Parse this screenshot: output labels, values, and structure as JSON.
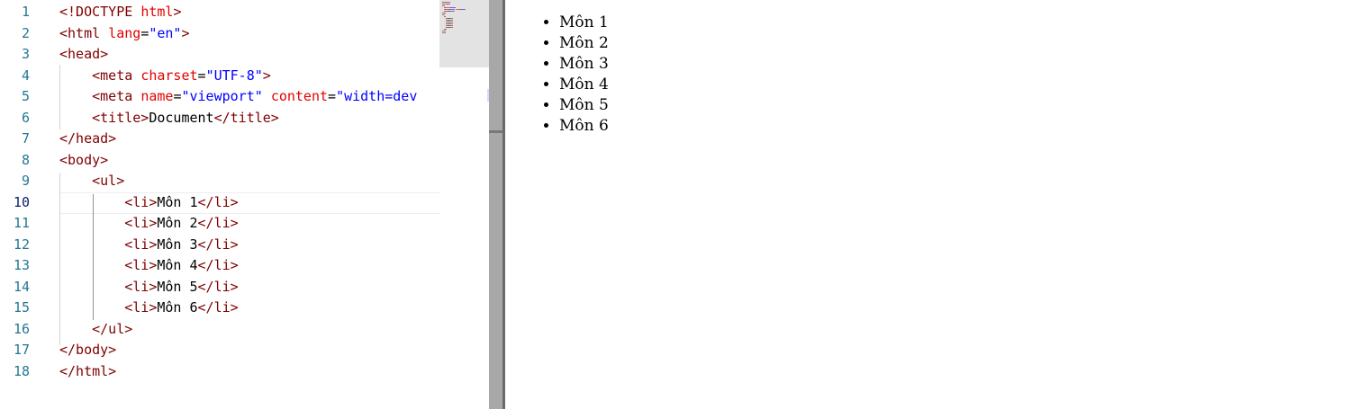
{
  "editor": {
    "active_line": 10,
    "lines": [
      {
        "n": "1",
        "tokens": [
          {
            "t": "tag",
            "v": "<!DOCTYPE "
          },
          {
            "t": "attr",
            "v": "html"
          },
          {
            "t": "tag",
            "v": ">"
          }
        ]
      },
      {
        "n": "2",
        "tokens": [
          {
            "t": "tag",
            "v": "<html "
          },
          {
            "t": "attr",
            "v": "lang"
          },
          {
            "t": "text",
            "v": "="
          },
          {
            "t": "val",
            "v": "\"en\""
          },
          {
            "t": "tag",
            "v": ">"
          }
        ]
      },
      {
        "n": "3",
        "tokens": [
          {
            "t": "tag",
            "v": "<head>"
          }
        ]
      },
      {
        "n": "4",
        "tokens": [
          {
            "t": "text",
            "v": "    "
          },
          {
            "t": "tag",
            "v": "<meta "
          },
          {
            "t": "attr",
            "v": "charset"
          },
          {
            "t": "text",
            "v": "="
          },
          {
            "t": "val",
            "v": "\"UTF-8\""
          },
          {
            "t": "tag",
            "v": ">"
          }
        ]
      },
      {
        "n": "5",
        "tokens": [
          {
            "t": "text",
            "v": "    "
          },
          {
            "t": "tag",
            "v": "<meta "
          },
          {
            "t": "attr",
            "v": "name"
          },
          {
            "t": "text",
            "v": "="
          },
          {
            "t": "val",
            "v": "\"viewport\""
          },
          {
            "t": "text",
            "v": " "
          },
          {
            "t": "attr",
            "v": "content"
          },
          {
            "t": "text",
            "v": "="
          },
          {
            "t": "val",
            "v": "\"width=dev"
          }
        ]
      },
      {
        "n": "6",
        "tokens": [
          {
            "t": "text",
            "v": "    "
          },
          {
            "t": "tag",
            "v": "<title>"
          },
          {
            "t": "text",
            "v": "Document"
          },
          {
            "t": "tag",
            "v": "</title>"
          }
        ]
      },
      {
        "n": "7",
        "tokens": [
          {
            "t": "tag",
            "v": "</head>"
          }
        ]
      },
      {
        "n": "8",
        "tokens": [
          {
            "t": "tag",
            "v": "<body>"
          }
        ]
      },
      {
        "n": "9",
        "tokens": [
          {
            "t": "text",
            "v": "    "
          },
          {
            "t": "tag",
            "v": "<ul>"
          }
        ]
      },
      {
        "n": "10",
        "tokens": [
          {
            "t": "text",
            "v": "        "
          },
          {
            "t": "tag",
            "v": "<li>"
          },
          {
            "t": "text",
            "v": "Môn 1"
          },
          {
            "t": "tag",
            "v": "</li>"
          }
        ]
      },
      {
        "n": "11",
        "tokens": [
          {
            "t": "text",
            "v": "        "
          },
          {
            "t": "tag",
            "v": "<li>"
          },
          {
            "t": "text",
            "v": "Môn 2"
          },
          {
            "t": "tag",
            "v": "</li>"
          }
        ]
      },
      {
        "n": "12",
        "tokens": [
          {
            "t": "text",
            "v": "        "
          },
          {
            "t": "tag",
            "v": "<li>"
          },
          {
            "t": "text",
            "v": "Môn 3"
          },
          {
            "t": "tag",
            "v": "</li>"
          }
        ]
      },
      {
        "n": "13",
        "tokens": [
          {
            "t": "text",
            "v": "        "
          },
          {
            "t": "tag",
            "v": "<li>"
          },
          {
            "t": "text",
            "v": "Môn 4"
          },
          {
            "t": "tag",
            "v": "</li>"
          }
        ]
      },
      {
        "n": "14",
        "tokens": [
          {
            "t": "text",
            "v": "        "
          },
          {
            "t": "tag",
            "v": "<li>"
          },
          {
            "t": "text",
            "v": "Môn 5"
          },
          {
            "t": "tag",
            "v": "</li>"
          }
        ]
      },
      {
        "n": "15",
        "tokens": [
          {
            "t": "text",
            "v": "        "
          },
          {
            "t": "tag",
            "v": "<li>"
          },
          {
            "t": "text",
            "v": "Môn 6"
          },
          {
            "t": "tag",
            "v": "</li>"
          }
        ]
      },
      {
        "n": "16",
        "tokens": [
          {
            "t": "text",
            "v": "    "
          },
          {
            "t": "tag",
            "v": "</ul>"
          }
        ]
      },
      {
        "n": "17",
        "tokens": [
          {
            "t": "tag",
            "v": "</body>"
          }
        ]
      },
      {
        "n": "18",
        "tokens": [
          {
            "t": "tag",
            "v": "</html>"
          }
        ]
      }
    ]
  },
  "preview": {
    "items": [
      "Môn 1",
      "Môn 2",
      "Môn 3",
      "Môn 4",
      "Môn 5",
      "Môn 6"
    ]
  }
}
